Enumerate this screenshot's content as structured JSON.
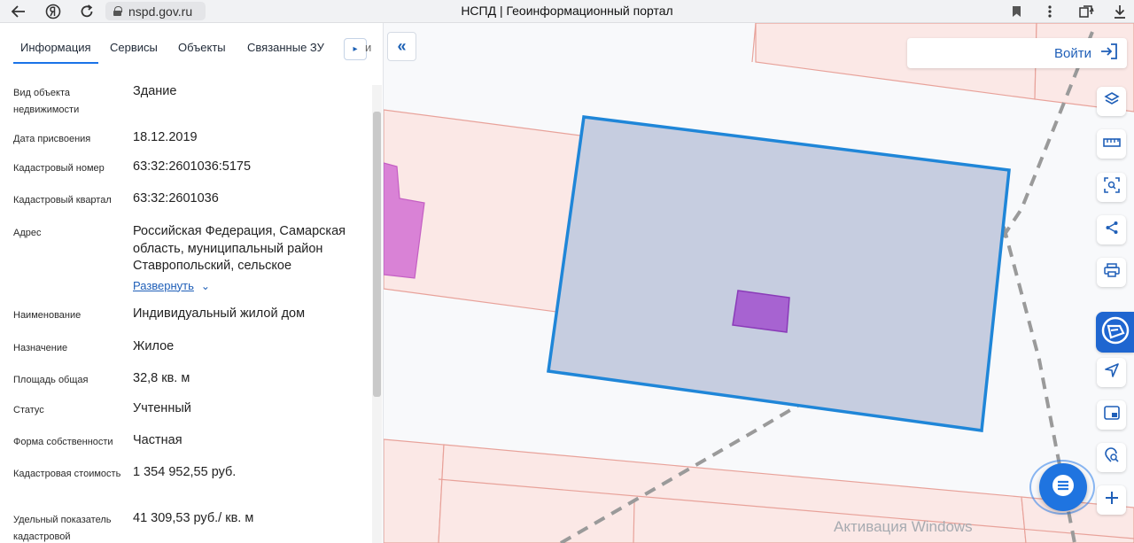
{
  "browser": {
    "url": "nspd.gov.ru",
    "page_title": "НСПД | Геоинформационный портал",
    "icons": [
      "back-arrow-icon",
      "yandex-logo-icon",
      "reload-icon",
      "lock-icon",
      "bookmark-icon",
      "more-icon",
      "collections-icon",
      "download-icon"
    ]
  },
  "panel": {
    "tabs": [
      {
        "label": "Информация",
        "active": true
      },
      {
        "label": "Сервисы",
        "active": false
      },
      {
        "label": "Объекты",
        "active": false
      },
      {
        "label": "Связанные ЗУ",
        "active": false
      }
    ],
    "tab_overflow_text": "и",
    "attributes": [
      {
        "label": "Вид объекта недвижимости",
        "value": "Здание"
      },
      {
        "label": "Дата присвоения",
        "value": "18.12.2019"
      },
      {
        "label": "Кадастровый номер",
        "value": "63:32:2601036:5175"
      },
      {
        "label": "Кадастровый квартал",
        "value": "63:32:2601036"
      },
      {
        "label": "Адрес",
        "value": "Российская Федерация, Самарская область, муниципальный район Ставропольский, сельское",
        "expand_label": "Развернуть"
      },
      {
        "label": "Наименование",
        "value": "Индивидуальный жилой дом"
      },
      {
        "label": "Назначение",
        "value": "Жилое"
      },
      {
        "label": "Площадь общая",
        "value": "32,8 кв. м"
      },
      {
        "label": "Статус",
        "value": "Учтенный"
      },
      {
        "label": "Форма собственности",
        "value": "Частная"
      },
      {
        "label": "Кадастровая стоимость",
        "value": "1 354 952,55 руб."
      },
      {
        "label": "Удельный показатель кадастровой",
        "value": "41 309,53 руб./ кв. м"
      }
    ]
  },
  "map": {
    "login_label": "Войти",
    "tools": [
      "layers-icon",
      "ruler-icon",
      "area-select-icon",
      "share-icon",
      "print-icon",
      "nspd-logo-icon",
      "geolocation-icon",
      "minimap-icon",
      "search-location-icon",
      "zoom-in-icon"
    ],
    "watermark": "Активация Windows",
    "colors": {
      "parcel_fill": "#fbe8e6",
      "parcel_stroke": "#e8a29a",
      "selected_fill": "#c6cde0",
      "selected_stroke": "#1f86d8",
      "building_fill": "#a763d1",
      "building_stroke": "#8a3bb8",
      "accent": "#1f66d0"
    }
  }
}
